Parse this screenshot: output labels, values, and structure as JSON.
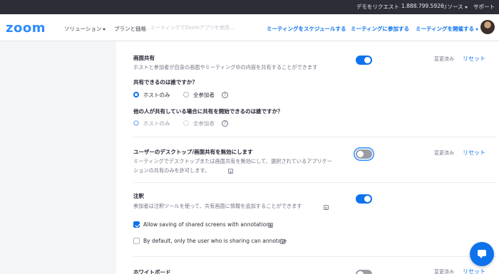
{
  "topbar": {
    "demo_request": "デモをリクエスト",
    "phone": "1.888.799.5926",
    "resources": "リソース",
    "support": "サポート"
  },
  "nav": {
    "logo": "zoom",
    "solutions": "ソリューション",
    "plans": "プランと価格",
    "ghost_text": "…ミーティングでZoomアプリを使用…",
    "schedule": "ミーティングをスケジュールする",
    "join": "ミーティングに参加する",
    "host": "ミーティングを開催する"
  },
  "settings": {
    "screen_share": {
      "title": "画面共有",
      "description": "ホストと参加者が自身の画面やミーティング中の内容を共有することができます",
      "enabled": true,
      "changed": "変更済み",
      "reset": "リセット",
      "who_can_share": {
        "question": "共有できるのは誰ですか？",
        "options": [
          "ホストのみ",
          "全参加者"
        ],
        "selected": "ホストのみ"
      },
      "who_can_start": {
        "question": "他の人が共有している場合に共有を開始できるのは誰ですか？",
        "options": [
          "ホストのみ",
          "全参加者"
        ],
        "selected": "ホストのみ"
      }
    },
    "disable_desktop_share": {
      "title": "ユーザーのデスクトップ/画面共有を無効にします",
      "description_line1": "ミーティングでデスクトップまたは画面共有を無効にして、選択されているアプリケー",
      "description_line2": "ションの共有のみを許可します。",
      "enabled": false,
      "changed": "変更済み",
      "reset": "リセット"
    },
    "annotation": {
      "title": "注釈",
      "description": "参加者は注釈ツールを使って、共有画面に情報を追加することができます",
      "enabled": true,
      "options": [
        {
          "label": "Allow saving of shared screens with annotations",
          "checked": true
        },
        {
          "label": "By default, only the user who is sharing can annotate",
          "checked": false
        }
      ]
    },
    "whiteboard": {
      "title": "ホワイトボード",
      "enabled": false,
      "changed": "変更済み",
      "reset": "リセット"
    }
  },
  "colors": {
    "accent": "#0e72ed",
    "brand": "#2d8cff",
    "topbar": "#2d2d37"
  }
}
